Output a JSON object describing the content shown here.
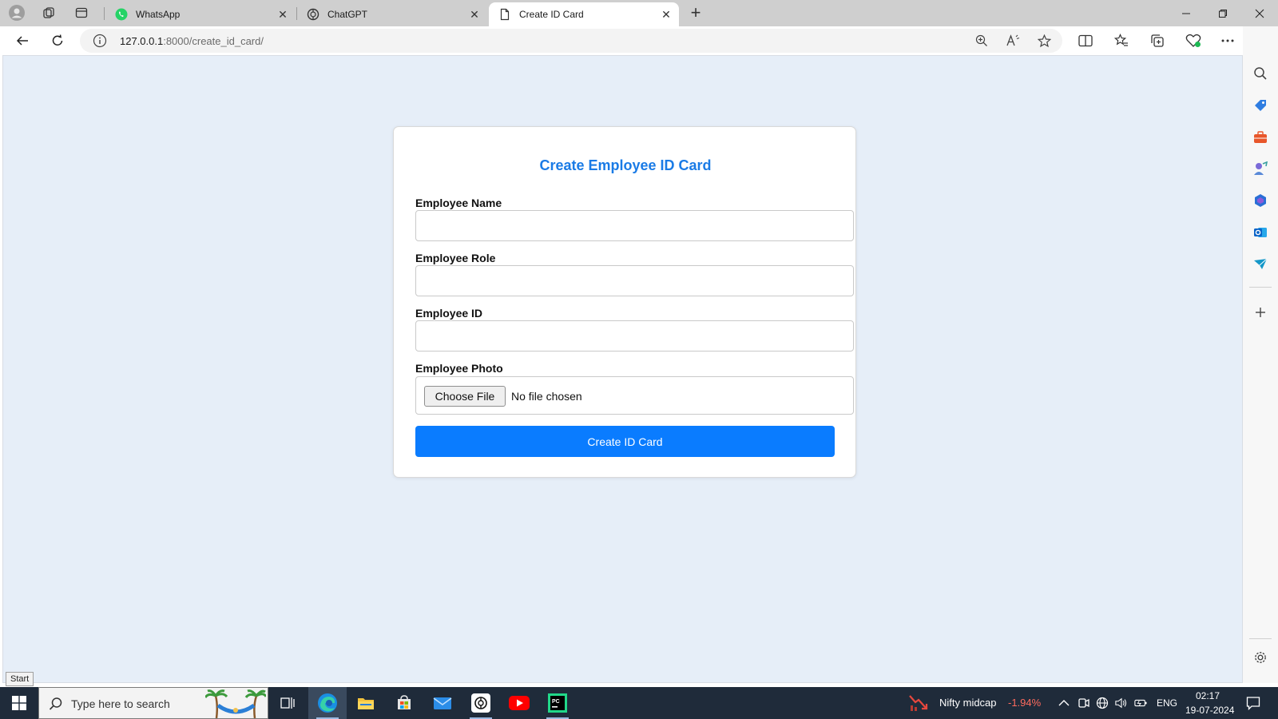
{
  "browser": {
    "tabs": [
      {
        "label": "WhatsApp",
        "icon": "whatsapp-icon"
      },
      {
        "label": "ChatGPT",
        "icon": "chatgpt-icon"
      },
      {
        "label": "Create ID Card",
        "icon": "page-icon",
        "active": true
      }
    ],
    "url_host": "127.0.0.1",
    "url_path": ":8000/create_id_card/"
  },
  "page": {
    "title": "Create Employee ID Card",
    "fields": [
      {
        "label": "Employee Name",
        "value": ""
      },
      {
        "label": "Employee Role",
        "value": ""
      },
      {
        "label": "Employee ID",
        "value": ""
      }
    ],
    "photo": {
      "label": "Employee Photo",
      "button": "Choose File",
      "status": "No file chosen"
    },
    "submit_label": "Create ID Card",
    "colors": {
      "accent": "#0a7cff",
      "title": "#1a7be6",
      "background": "#e6eef8"
    }
  },
  "os": {
    "start_tooltip": "Start",
    "search_placeholder": "Type here to search",
    "stock_name": "Nifty midcap",
    "stock_change": "-1.94%",
    "language": "ENG",
    "time": "02:17",
    "date": "19-07-2024"
  }
}
